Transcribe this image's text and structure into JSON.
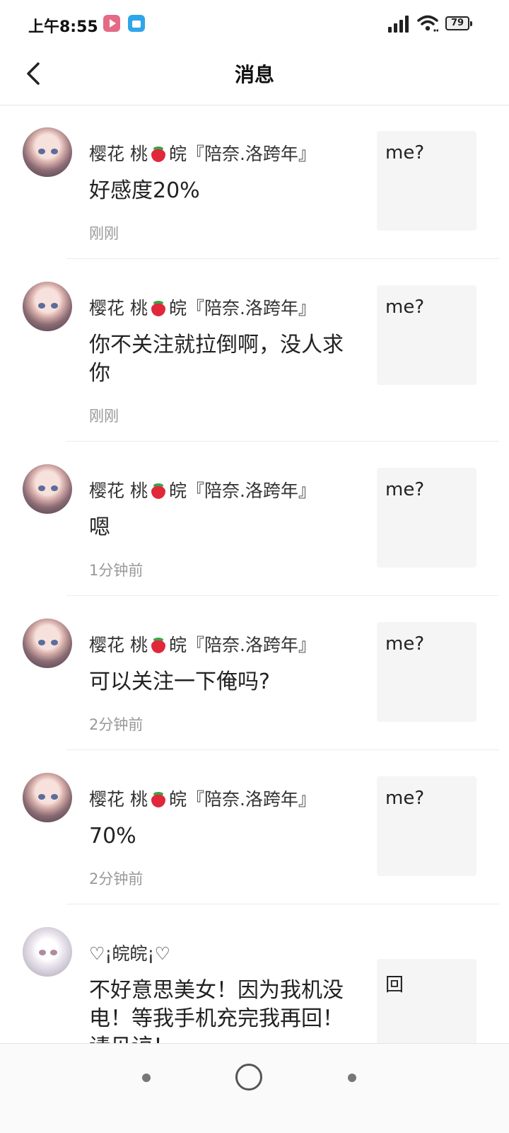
{
  "status_bar": {
    "time": "上午8:55",
    "battery": "79"
  },
  "header": {
    "title": "消息"
  },
  "messages": [
    {
      "name_before": "樱花 桃",
      "name_after": "皖『陪奈.洛跨年』",
      "text": "好感度20%",
      "time": "刚刚",
      "preview": "me?"
    },
    {
      "name_before": "樱花 桃",
      "name_after": "皖『陪奈.洛跨年』",
      "text": "你不关注就拉倒啊，没人求你",
      "time": "刚刚",
      "preview": "me?"
    },
    {
      "name_before": "樱花 桃",
      "name_after": "皖『陪奈.洛跨年』",
      "text": "嗯",
      "time": "1分钟前",
      "preview": "me?"
    },
    {
      "name_before": "樱花 桃",
      "name_after": "皖『陪奈.洛跨年』",
      "text": "可以关注一下俺吗?",
      "time": "2分钟前",
      "preview": "me?"
    },
    {
      "name_before": "樱花 桃",
      "name_after": "皖『陪奈.洛跨年』",
      "text": "70%",
      "time": "2分钟前",
      "preview": "me?"
    },
    {
      "name": "♡¡皖皖¡♡",
      "text": "不好意思美女！因为我机没电！等我手机充完我再回！请见谅！",
      "preview": "回"
    }
  ]
}
